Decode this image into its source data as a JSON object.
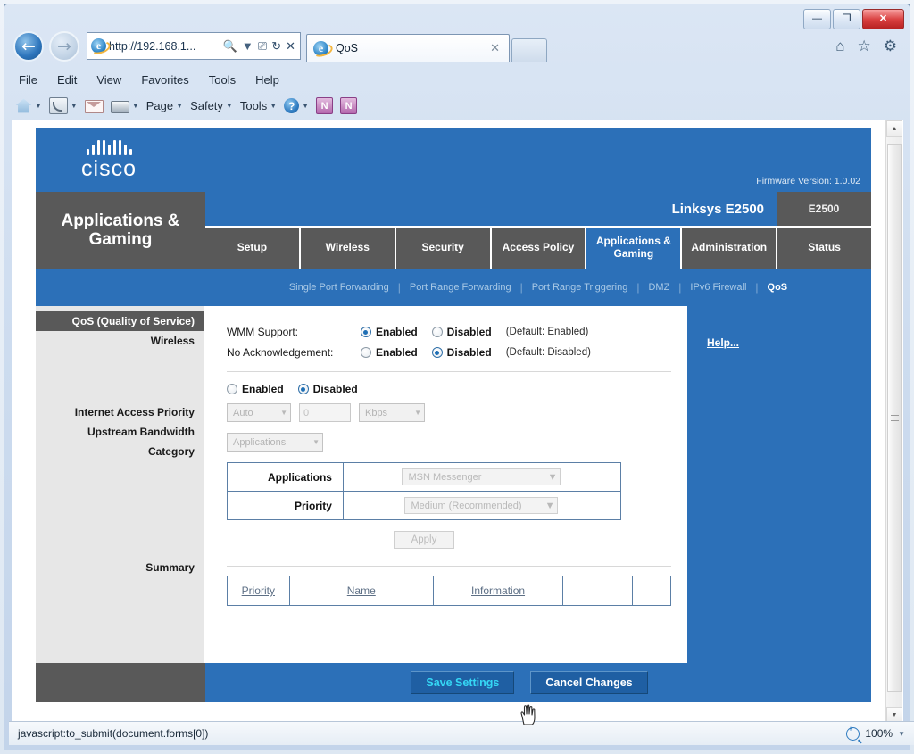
{
  "browser": {
    "window_controls": {
      "minimize": "—",
      "maximize": "❐",
      "close": "✕"
    },
    "address": "http://192.168.1...",
    "tab_title": "QoS",
    "menu": [
      "File",
      "Edit",
      "View",
      "Favorites",
      "Tools",
      "Help"
    ],
    "command_bar": [
      "Page",
      "Safety",
      "Tools"
    ],
    "status_text": "javascript:to_submit(document.forms[0])",
    "zoom_level": "100%"
  },
  "router": {
    "brand": "cisco",
    "firmware": "Firmware Version: 1.0.02",
    "model_name": "Linksys E2500",
    "model_code": "E2500",
    "page_title": "Applications & Gaming",
    "tabs": [
      {
        "label": "Setup",
        "active": false
      },
      {
        "label": "Wireless",
        "active": false
      },
      {
        "label": "Security",
        "active": false
      },
      {
        "label": "Access Policy",
        "active": false
      },
      {
        "label": "Applications & Gaming",
        "active": true
      },
      {
        "label": "Administration",
        "active": false
      },
      {
        "label": "Status",
        "active": false
      }
    ],
    "subnav": [
      {
        "label": "Single Port Forwarding",
        "active": false
      },
      {
        "label": "Port Range Forwarding",
        "active": false
      },
      {
        "label": "Port Range Triggering",
        "active": false
      },
      {
        "label": "DMZ",
        "active": false
      },
      {
        "label": "IPv6 Firewall",
        "active": false
      },
      {
        "label": "QoS",
        "active": true
      }
    ],
    "sidebar": [
      {
        "label": "QoS (Quality of Service)",
        "active": true
      },
      {
        "label": "Wireless",
        "active": false
      },
      {
        "label": "Internet Access Priority",
        "active": false
      },
      {
        "label": "Upstream Bandwidth",
        "active": false
      },
      {
        "label": "Category",
        "active": false
      },
      {
        "label": "Summary",
        "active": false
      }
    ],
    "form": {
      "wmm_label": "WMM Support:",
      "wmm_enabled": "Enabled",
      "wmm_disabled": "Disabled",
      "wmm_default": "(Default: Enabled)",
      "noack_label": "No Acknowledgement:",
      "noack_enabled": "Enabled",
      "noack_disabled": "Disabled",
      "noack_default": "(Default: Disabled)",
      "priority_enabled": "Enabled",
      "priority_disabled": "Disabled",
      "bandwidth_mode": "Auto",
      "bandwidth_value": "0",
      "bandwidth_unit": "Kbps",
      "category_value": "Applications",
      "applications_row_label": "Applications",
      "applications_value": "MSN Messenger",
      "priority_row_label": "Priority",
      "priority_value": "Medium (Recommended)",
      "apply_label": "Apply"
    },
    "summary_headers": [
      "Priority",
      "Name",
      "Information",
      "",
      ""
    ],
    "help_label": "Help...",
    "footer": {
      "save_label": "Save Settings",
      "cancel_label": "Cancel Changes"
    }
  },
  "colors": {
    "cisco_blue": "#2c70b8",
    "dark_gray": "#595959",
    "sidebar_gray": "#e7e7e7",
    "hover_text": "#35d7f5"
  }
}
